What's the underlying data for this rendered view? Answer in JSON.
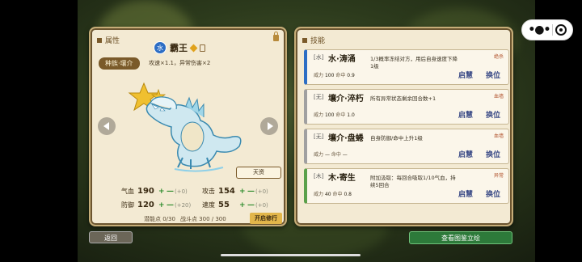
{
  "colors": {
    "panel_bg": "#f3ead3",
    "panel_border": "#c6ad78",
    "element_water": "#2d6ec4",
    "element_wood": "#5aa04a",
    "element_none": "#a0a0a0",
    "action_green": "#2d7a3a",
    "skill_button_blue": "#3a4a86"
  },
  "capsule": {
    "more_icon": "more-icon",
    "close_icon": "target-icon"
  },
  "left_panel": {
    "title": "属性",
    "pet": {
      "element_badge": "水",
      "name": "霸王",
      "race_tag": "种族·壤介",
      "race_desc": "攻速×1.1，异常伤害×2"
    },
    "talent_button": "天资",
    "stats": [
      {
        "label": "气血",
        "value": "190",
        "plus": "+",
        "minus": "—",
        "delta": "(+0)"
      },
      {
        "label": "攻击",
        "value": "154",
        "plus": "+",
        "minus": "—",
        "delta": "(+0)"
      },
      {
        "label": "防御",
        "value": "120",
        "plus": "+",
        "minus": "—",
        "delta": "(+20)"
      },
      {
        "label": "速度",
        "value": "55",
        "plus": "+",
        "minus": "—",
        "delta": "(+0)"
      }
    ],
    "potential": "潜能点 0/30",
    "battle_points": "战斗点 300 / 300",
    "practice_button": "开启修行"
  },
  "right_panel": {
    "title": "技能",
    "skills": [
      {
        "element": "[水]",
        "name": "水·涛涌",
        "power_label": "威力",
        "power": "100",
        "hit_label": "命中",
        "hit": "0.9",
        "desc": "1/3概率冻结对方，用后自身速度下降1级",
        "tag": "绝杀",
        "btn1": "启慧",
        "btn2": "换位",
        "accent": "#2d6ec4"
      },
      {
        "element": "[无]",
        "name": "壤介·淬朽",
        "power_label": "威力",
        "power": "100",
        "hit_label": "命中",
        "hit": "1.0",
        "desc": "所有异常状态剩余回合数+1",
        "tag": "血墙",
        "btn1": "启慧",
        "btn2": "换位",
        "accent": "#a0a0a0"
      },
      {
        "element": "[无]",
        "name": "壤介·盘蜷",
        "power_label": "威力",
        "power": "—",
        "hit_label": "命中",
        "hit": "—",
        "desc": "自身防御/命中上升1级",
        "tag": "血墙",
        "btn1": "启慧",
        "btn2": "换位",
        "accent": "#a0a0a0"
      },
      {
        "element": "[木]",
        "name": "木·寄生",
        "power_label": "威力",
        "power": "40",
        "hit_label": "命中",
        "hit": "0.8",
        "desc": "附加汲取：每回合吸取1/10气血，持续5回合",
        "tag": "异常",
        "btn1": "启慧",
        "btn2": "换位",
        "accent": "#5aa04a"
      }
    ]
  },
  "footer": {
    "back_button": "返回",
    "view_button": "查看图鉴立绘"
  }
}
